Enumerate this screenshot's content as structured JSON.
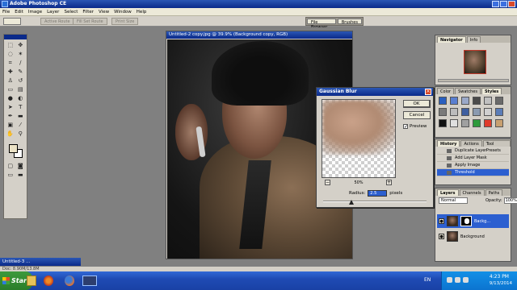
{
  "app": {
    "title": "Adobe Photoshop CE"
  },
  "menu": [
    "File",
    "Edit",
    "Image",
    "Layer",
    "Select",
    "Filter",
    "View",
    "Window",
    "Help"
  ],
  "options_bar": {
    "buttons": [
      "Active Route",
      "Fill Set Route",
      "Print Size"
    ],
    "well_tabs": [
      "File Browser",
      "Brushes"
    ]
  },
  "document": {
    "title": "Untitled-2 copy.jpg @ 39.9% (Background copy, RGB)"
  },
  "gaussian_blur": {
    "title": "Gaussian Blur",
    "ok_label": "OK",
    "cancel_label": "Cancel",
    "preview_label": "Preview",
    "preview_checked": true,
    "zoom_value": "50%",
    "radius_label": "Radius:",
    "radius_value": "2.5",
    "radius_unit": "pixels",
    "slider_position": 0.27
  },
  "navigator": {
    "tabs": [
      "Navigator",
      "Info"
    ]
  },
  "styles": {
    "tabs": [
      "Color",
      "Swatches",
      "Styles"
    ],
    "swatch_colors": [
      "#2a5fbf",
      "#5a7fd0",
      "#9aa8c8",
      "#4a4a4a",
      "#c0c0c0",
      "#6a6a6a",
      "#7a7a7a",
      "#bcbcbc",
      "#3f5fa0",
      "#8a9ab0",
      "#d0d0d0",
      "#5b7db8",
      "#111111",
      "#e0e0e0",
      "#a0a0a0",
      "#2e9a3a",
      "#e03a2a",
      "#c8a070"
    ]
  },
  "history": {
    "tabs": [
      "History",
      "Actions",
      "Tool Presets"
    ],
    "items": [
      "Duplicate Layer",
      "Add Layer Mask",
      "Apply Image",
      "Threshold"
    ],
    "active_index": 3
  },
  "layers": {
    "tabs": [
      "Layers",
      "Channels",
      "Paths"
    ],
    "blend_mode": "Normal",
    "opacity_label": "Opacity:",
    "opacity_value": "100%",
    "rows": [
      {
        "name": "Backg...",
        "active": true
      },
      {
        "name": "Background",
        "active": false
      }
    ]
  },
  "minimized_doc": {
    "title": "Untitled-3 ..."
  },
  "status": {
    "text": "Doc: 8.90M/13.8M"
  },
  "taskbar": {
    "start_label": "Start",
    "lang": "EN",
    "time": "4:23 PM",
    "date": "9/13/2014"
  }
}
